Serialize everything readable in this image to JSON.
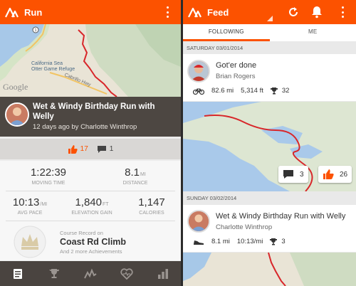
{
  "left": {
    "app_title": "Run",
    "map_labels": {
      "sanctuary": "California Sea\nOtter Game Refuge",
      "road": "Cabrillo Hwy",
      "google": "Google"
    },
    "activity": {
      "title": "Wet & Windy Birthday Run with Welly",
      "subtitle": "12 days ago by Charlotte Winthrop",
      "kudos_count": "17",
      "comment_count": "1"
    },
    "stats": {
      "moving_time": {
        "value": "1:22:39",
        "label": "MOVING TIME"
      },
      "distance": {
        "value": "8.1",
        "unit": "MI",
        "label": "DISTANCE"
      },
      "avg_pace": {
        "value": "10:13",
        "unit": "/MI",
        "label": "AVG PACE"
      },
      "elevation": {
        "value": "1,840",
        "unit": "FT",
        "label": "ELEVATION GAIN"
      },
      "calories": {
        "value": "1,147",
        "label": "CALORIES"
      }
    },
    "record": {
      "small": "Course Record on",
      "name": "Coast Rd Climb",
      "sub": "And 2 more Achievements"
    },
    "nav": [
      "feed-icon",
      "trophy-icon",
      "activity-icon",
      "heart-icon",
      "stats-icon"
    ]
  },
  "right": {
    "app_title": "Feed",
    "tabs": [
      "FOLLOWING",
      "ME"
    ],
    "date1": "SATURDAY 03/01/2014",
    "entry1": {
      "title": "Got'er done",
      "athlete": "Brian Rogers",
      "distance": "82.6 mi",
      "elevation": "5,314 ft",
      "achievements": "32",
      "comments": "3",
      "kudos": "26"
    },
    "date2": "SUNDAY 03/02/2014",
    "entry2": {
      "title": "Wet & Windy Birthday Run with Welly",
      "athlete": "Charlotte Winthrop",
      "distance": "8.1 mi",
      "pace": "10:13/mi",
      "achievements": "3"
    }
  },
  "colors": {
    "accent": "#fc5200",
    "header_dark": "#4d4742"
  }
}
